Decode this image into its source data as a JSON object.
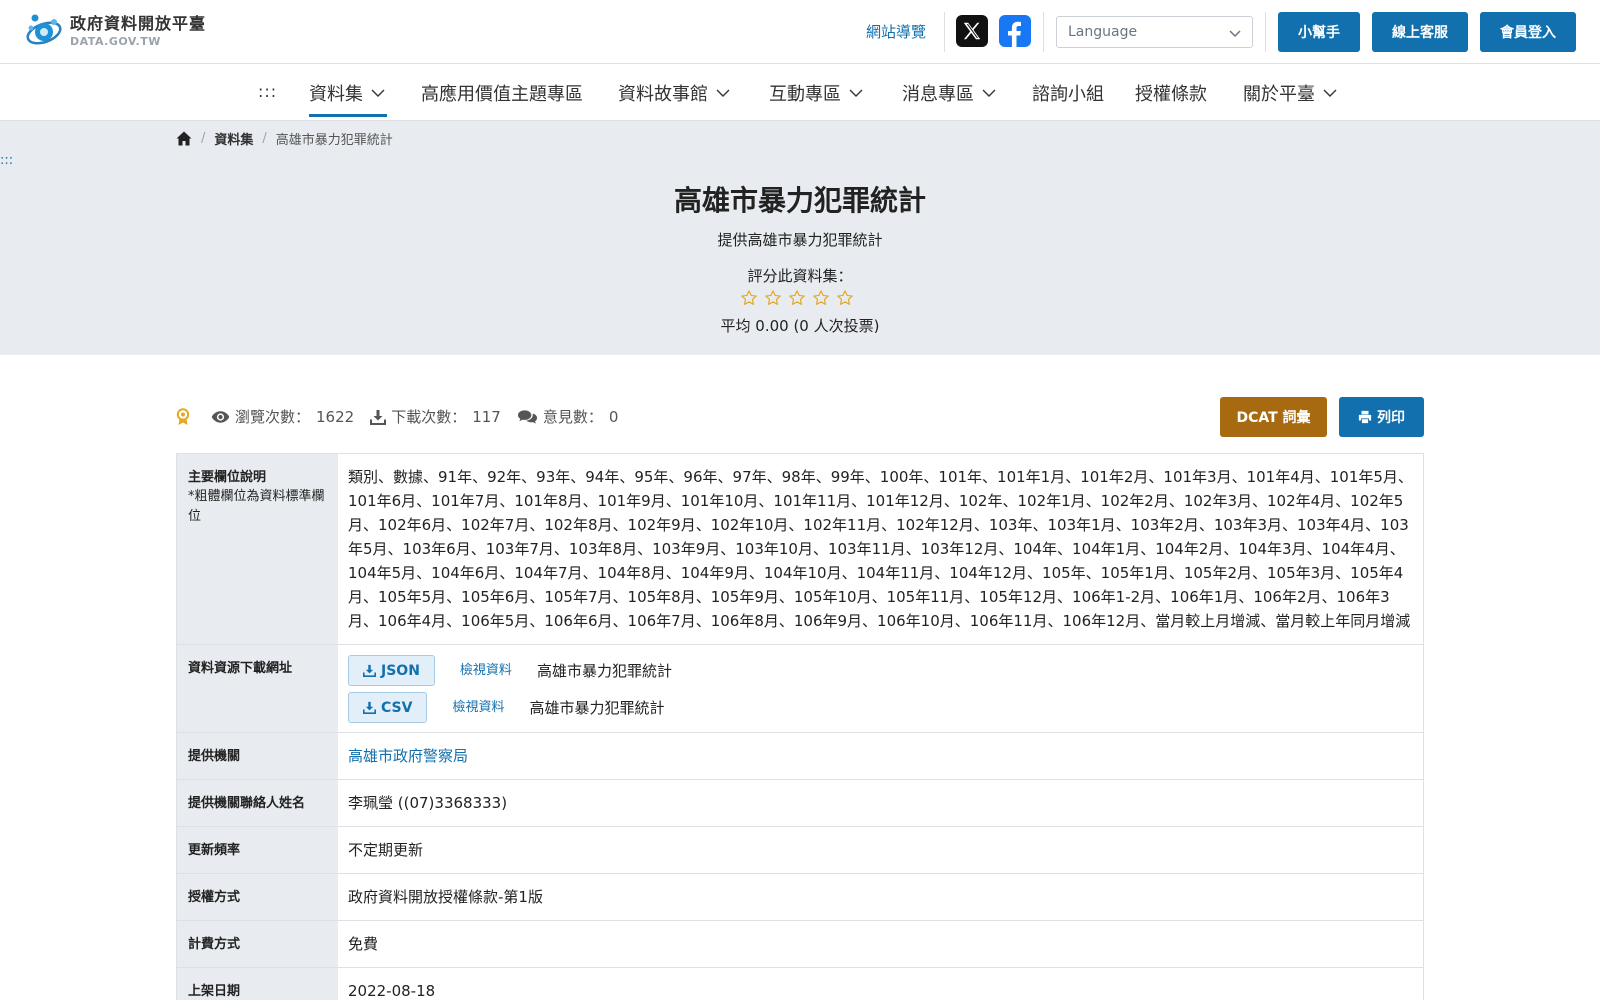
{
  "brand": {
    "name_cn": "政府資料開放平臺",
    "name_en": "DATA.GOV.TW"
  },
  "header": {
    "site_nav": "網站導覽",
    "language_placeholder": "Language",
    "buttons": {
      "helper": "小幫手",
      "support": "線上客服",
      "login": "會員登入"
    },
    "social": [
      {
        "icon": "x-icon"
      },
      {
        "icon": "facebook-icon"
      }
    ]
  },
  "nav": {
    "dots": ":::",
    "items": [
      {
        "label": "資料集",
        "dropdown": true,
        "active": true
      },
      {
        "label": "高應用價值主題專區",
        "dropdown": false
      },
      {
        "label": "資料故事館",
        "dropdown": true
      },
      {
        "label": "互動專區",
        "dropdown": true
      },
      {
        "label": "消息專區",
        "dropdown": true
      },
      {
        "label": "諮詢小組",
        "dropdown": false
      },
      {
        "label": "授權條款",
        "dropdown": false
      },
      {
        "label": "關於平臺",
        "dropdown": true
      }
    ]
  },
  "breadcrumb": {
    "sep": "/",
    "level1": "資料集",
    "current": "高雄市暴力犯罪統計"
  },
  "side_dots": ":::",
  "dataset": {
    "title": "高雄市暴力犯罪統計",
    "subtitle": "提供高雄市暴力犯罪統計",
    "rate_label": "評分此資料集：",
    "rating_average": "平均 0.00 (0 人次投票)",
    "stars_filled": 0,
    "stars_total": 5
  },
  "stats": {
    "views_label": "瀏覽次數：",
    "views": "1622",
    "downloads_label": "下載次數：",
    "downloads": "117",
    "comments_label": "意見數：",
    "comments": "0"
  },
  "actions": {
    "dcat": "DCAT 詞彙",
    "print": "列印"
  },
  "details": {
    "fields_label": "主要欄位說明",
    "fields_note": "*粗體欄位為資料標準欄位",
    "fields_text": "類別、數據、91年、92年、93年、94年、95年、96年、97年、98年、99年、100年、101年、101年1月、101年2月、101年3月、101年4月、101年5月、101年6月、101年7月、101年8月、101年9月、101年10月、101年11月、101年12月、102年、102年1月、102年2月、102年3月、102年4月、102年5月、102年6月、102年7月、102年8月、102年9月、102年10月、102年11月、102年12月、103年、103年1月、103年2月、103年3月、103年4月、103年5月、103年6月、103年7月、103年8月、103年9月、103年10月、103年11月、103年12月、104年、104年1月、104年2月、104年3月、104年4月、104年5月、104年6月、104年7月、104年8月、104年9月、104年10月、104年11月、104年12月、105年、105年1月、105年2月、105年3月、105年4月、105年5月、105年6月、105年7月、105年8月、105年9月、105年10月、105年11月、105年12月、106年1-2月、106年1月、106年2月、106年3月、106年4月、106年5月、106年6月、106年7月、106年8月、106年9月、106年10月、106年11月、106年12月、當月較上月增減、當月較上年同月增減",
    "resources_label": "資料資源下載網址",
    "resources": [
      {
        "format": "JSON",
        "view": "檢視資料",
        "name": "高雄市暴力犯罪統計"
      },
      {
        "format": "CSV",
        "view": "檢視資料",
        "name": "高雄市暴力犯罪統計"
      }
    ],
    "org_label": "提供機關",
    "org": "高雄市政府警察局",
    "contact_label": "提供機關聯絡人姓名",
    "contact": "李珮瑩 ((07)3368333)",
    "freq_label": "更新頻率",
    "freq": "不定期更新",
    "license_label": "授權方式",
    "license": "政府資料開放授權條款-第1版",
    "fee_label": "計費方式",
    "fee": "免費",
    "date_label": "上架日期",
    "date": "2022-08-18"
  },
  "colors": {
    "primary": "#1170ad",
    "dcat": "#a86a10",
    "hero_bg": "#e8ecf0",
    "star": "#e6a820"
  }
}
